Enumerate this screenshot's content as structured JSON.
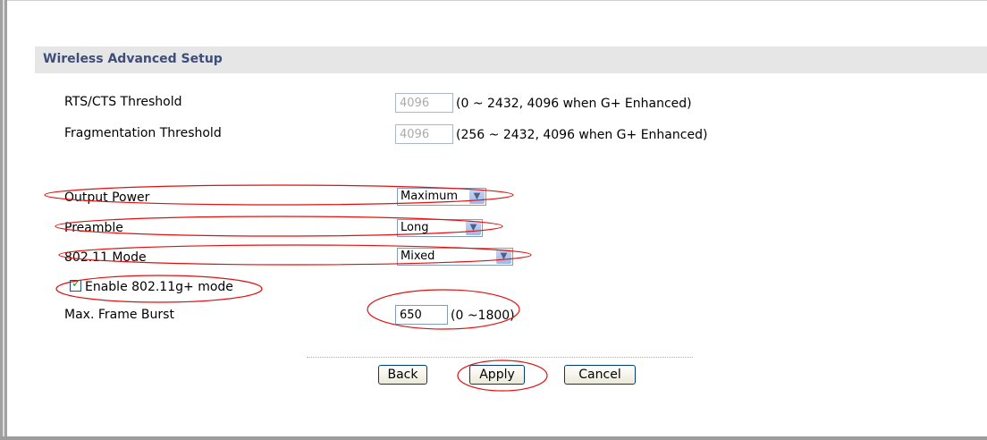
{
  "section": {
    "title": "Wireless Advanced Setup"
  },
  "rts": {
    "label": "RTS/CTS  Threshold",
    "value": "4096",
    "hint": "(0 ~ 2432, 4096 when G+ Enhanced)"
  },
  "frag": {
    "label": "Fragmentation  Threshold",
    "value": "4096",
    "hint": "(256 ~ 2432, 4096 when G+ Enhanced)"
  },
  "output_power": {
    "label": "Output Power",
    "selected": "Maximum"
  },
  "preamble": {
    "label": "Preamble",
    "selected": "Long"
  },
  "mode": {
    "label": "802.11 Mode",
    "selected": "Mixed"
  },
  "gplus": {
    "label": "Enable 802.11g+ mode",
    "checked": true
  },
  "burst": {
    "label": "Max. Frame Burst",
    "value": "650",
    "hint": "(0 ~1800)"
  },
  "buttons": {
    "back": "Back",
    "apply": "Apply",
    "cancel": "Cancel"
  },
  "colors": {
    "header_bg": "#e6e6e6",
    "header_text": "#3e4e7a",
    "annotation": "#e01010"
  },
  "icons": {
    "dropdown": "chevron-down-icon",
    "checkbox": "checkmark-icon"
  }
}
